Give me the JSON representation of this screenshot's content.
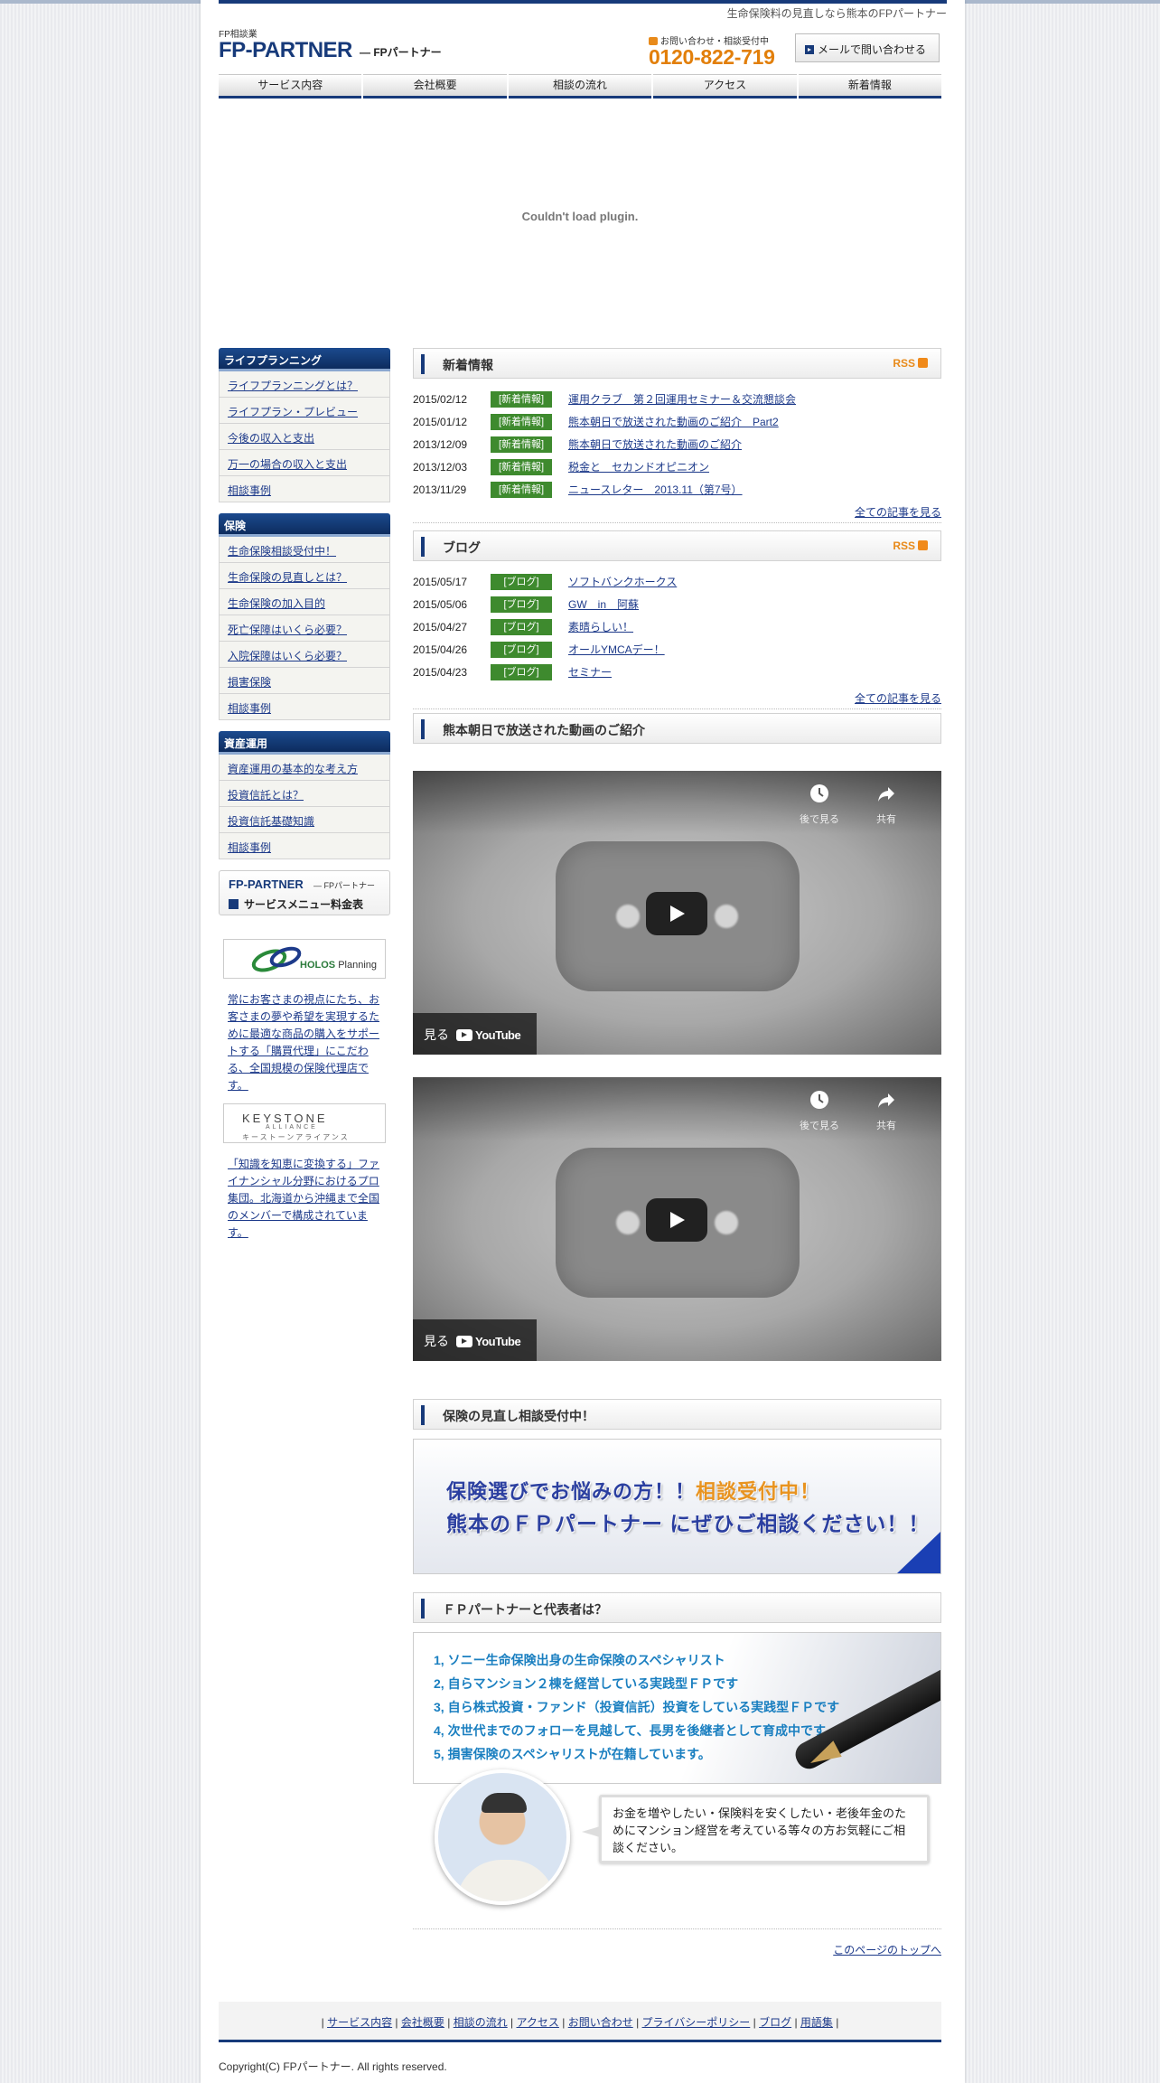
{
  "header": {
    "tagline": "生命保険料の見直しなら熊本のFPパートナー",
    "logo_small": "FP相談業",
    "logo_main": "FP-PARTNER",
    "logo_sub": "— FPパートナー",
    "tel_label": "お問い合わせ・相談受付中",
    "tel_number": "0120-822-719",
    "mail_button": "メールで問い合わせる"
  },
  "nav": [
    "サービス内容",
    "会社概要",
    "相談の流れ",
    "アクセス",
    "新着情報"
  ],
  "plugin_message": "Couldn't load plugin.",
  "sidebar": {
    "blocks": [
      {
        "title": "ライフプランニング",
        "items": [
          "ライフプランニングとは？",
          "ライフプラン・プレビュー",
          "今後の収入と支出",
          "万一の場合の収入と支出",
          "相談事例"
        ]
      },
      {
        "title": "保険",
        "items": [
          "生命保険相談受付中！",
          "生命保険の見直しとは？",
          "生命保険の加入目的",
          "死亡保障はいくら必要？",
          "入院保障はいくら必要？",
          "損害保険",
          "相談事例"
        ]
      },
      {
        "title": "資産運用",
        "items": [
          "資産運用の基本的な考え方",
          "投資信託とは？",
          "投資信託基礎知識",
          "相談事例"
        ]
      }
    ],
    "fp_banner": {
      "title": "FP-PARTNER",
      "title_sub": "— FPパートナー",
      "label": "サービスメニュー料金表"
    },
    "holos": {
      "logo_text": "HOLOS",
      "logo_text2": "Planning",
      "description": "常にお客さまの視点にたち、お客さまの夢や希望を実現するために最適な商品の購入をサポートする「購買代理」にこだわる、全国規模の保険代理店です。"
    },
    "keystone": {
      "logo_text": "KEYSTONE",
      "logo_sub": "ALLIANCE",
      "logo_kana": "キーストーンアライアンス",
      "description": "「知識を知恵に変換する」ファイナンシャル分野におけるプロ集団。北海道から沖縄まで全国のメンバーで構成されています。"
    }
  },
  "news": {
    "title": "新着情報",
    "rss": "RSS",
    "items": [
      {
        "date": "2015/02/12",
        "tag": "[新着情報]",
        "title": "運用クラブ　第２回運用セミナー＆交流懇談会"
      },
      {
        "date": "2015/01/12",
        "tag": "[新着情報]",
        "title": "熊本朝日で放送された動画のご紹介　Part2"
      },
      {
        "date": "2013/12/09",
        "tag": "[新着情報]",
        "title": "熊本朝日で放送された動画のご紹介"
      },
      {
        "date": "2013/12/03",
        "tag": "[新着情報]",
        "title": "税金と　セカンドオピニオン"
      },
      {
        "date": "2013/11/29",
        "tag": "[新着情報]",
        "title": "ニュースレター　2013.11（第7号）"
      }
    ],
    "more": "全ての記事を見る"
  },
  "blog": {
    "title": "ブログ",
    "rss": "RSS",
    "items": [
      {
        "date": "2015/05/17",
        "tag": "[ブログ]",
        "title": "ソフトバンクホークス"
      },
      {
        "date": "2015/05/06",
        "tag": "[ブログ]",
        "title": "GW　in　阿蘇"
      },
      {
        "date": "2015/04/27",
        "tag": "[ブログ]",
        "title": "素晴らしい！"
      },
      {
        "date": "2015/04/26",
        "tag": "[ブログ]",
        "title": "オールYMCAデー！"
      },
      {
        "date": "2015/04/23",
        "tag": "[ブログ]",
        "title": "セミナー"
      }
    ],
    "more": "全ての記事を見る"
  },
  "video_section": {
    "title": "熊本朝日で放送された動画のご紹介",
    "watch_later": "後で見る",
    "share": "共有",
    "watch": "見る",
    "youtube": "YouTube"
  },
  "consult": {
    "title": "保険の見直し相談受付中！",
    "line1a": "保険選びでお悩みの方！！",
    "line1b": "相談受付中！",
    "line2": "熊本のＦＰパートナー にぜひご相談ください！！"
  },
  "about": {
    "title": "ＦＰパートナーと代表者は？",
    "points": [
      "1, ソニー生命保険出身の生命保険のスペシャリスト",
      "2, 自らマンション２棟を経営している実践型ＦＰです",
      "3, 自ら株式投資・ファンド（投資信託）投資をしている実践型ＦＰです",
      "4, 次世代までのフォローを見越して、長男を後継者として育成中です。",
      "5, 損害保険のスペシャリストが在籍しています。"
    ],
    "message": "お金を増やしたい・保険料を安くしたい・老後年金のためにマンション経営を考えている等々の方お気軽にご相談ください。"
  },
  "pagetop": "このページのトップへ",
  "footer": {
    "links": [
      "サービス内容",
      "会社概要",
      "相談の流れ",
      "アクセス",
      "お問い合わせ",
      "プライバシーポリシー",
      "ブログ",
      "用語集"
    ],
    "copyright": "Copyright(C) FPパートナー. All rights reserved."
  }
}
